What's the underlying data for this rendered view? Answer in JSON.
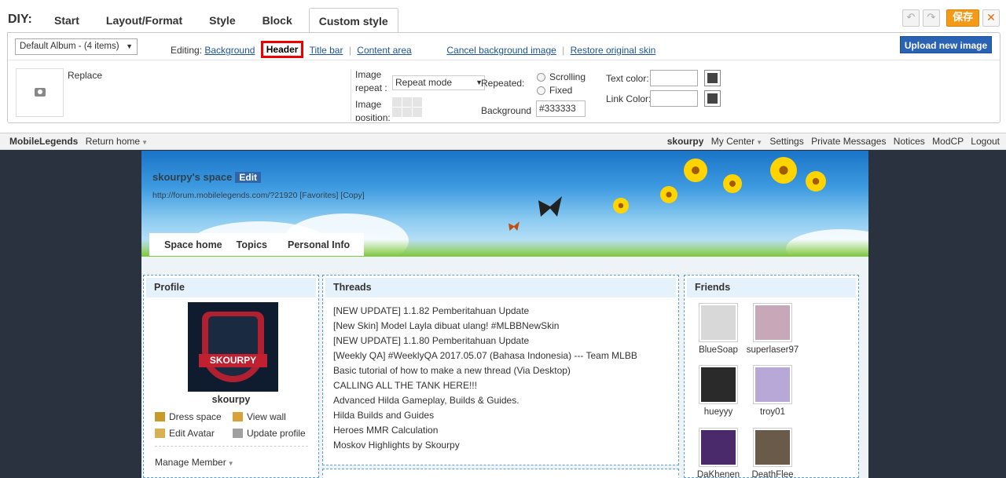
{
  "diy": {
    "title": "DIY:",
    "tabs": [
      {
        "label": "Start"
      },
      {
        "label": "Layout/Format"
      },
      {
        "label": "Style"
      },
      {
        "label": "Block"
      },
      {
        "label": "Custom style",
        "active": true
      }
    ],
    "undo_icon": "undo-icon",
    "redo_icon": "redo-icon",
    "save_label": "保存",
    "close_label": "✕"
  },
  "editor": {
    "album_select": "Default Album - (4 items)",
    "editing_label": "Editing:",
    "editing_links": [
      "Background",
      "Header",
      "Title bar",
      "Content area"
    ],
    "selected_link": "Header",
    "cancel_bg": "Cancel background image",
    "restore_skin": "Restore original skin",
    "upload_label": "Upload new image",
    "replace_label": "Replace",
    "image_repeat_label_1": "Image",
    "image_repeat_label_2": "repeat :",
    "repeat_mode": "Repeat mode",
    "image_position_label_1": "Image",
    "image_position_label_2": "position:",
    "repeated_label": "Repeated:",
    "scrolling_label": "Scrolling",
    "fixed_label": "Fixed",
    "background_label": "Background",
    "background_hex": "#333333",
    "text_color_label": "Text color:",
    "link_color_label": "Link Color:"
  },
  "topbar": {
    "site": "MobileLegends",
    "return_home": "Return home",
    "user": "skourpy",
    "items": [
      "My Center",
      "Settings",
      "Private Messages",
      "Notices",
      "ModCP",
      "Logout"
    ]
  },
  "space": {
    "title": "skourpy's space",
    "edit_label": "Edit",
    "url_line": "http://forum.mobilelegends.com/?21920 [Favorites] [Copy]",
    "nav": [
      "Space home",
      "Topics",
      "Personal Info"
    ]
  },
  "profile": {
    "heading": "Profile",
    "avatar_text": "SKOURPY",
    "username": "skourpy",
    "actions": [
      "Dress space",
      "View wall",
      "Edit Avatar",
      "Update profile"
    ],
    "manage": "Manage Member"
  },
  "threads": {
    "heading": "Threads",
    "items": [
      "[NEW UPDATE] 1.1.82 Pemberitahuan Update",
      "[New Skin] Model Layla dibuat ulang! #MLBBNewSkin",
      "[NEW UPDATE] 1.1.80 Pemberitahuan Update",
      "[Weekly QA] #WeeklyQA 2017.05.07 (Bahasa Indonesia) --- Team MLBB",
      "Basic tutorial of how to make a new thread (Via Desktop)",
      "CALLING ALL THE TANK HERE!!!",
      "Advanced Hilda Gameplay, Builds & Guides.",
      "Hilda Builds and Guides",
      "Heroes MMR Calculation",
      "Moskov Highlights by Skourpy"
    ]
  },
  "friends": {
    "heading": "Friends",
    "items": [
      {
        "name": "BlueSoap",
        "color": "#d8d8d8"
      },
      {
        "name": "superlaser97",
        "color": "#c8a8b8"
      },
      {
        "name": "hueyyy",
        "color": "#2a2a2a"
      },
      {
        "name": "troy01",
        "color": "#b8a8d8"
      },
      {
        "name": "DaKhenen",
        "color": "#4a2a6a"
      },
      {
        "name": "DeathFlee",
        "color": "#6a5a4a"
      }
    ]
  },
  "colors": {
    "accent": "#2a62b4",
    "save": "#f39b19",
    "highlight": "#e00000"
  }
}
